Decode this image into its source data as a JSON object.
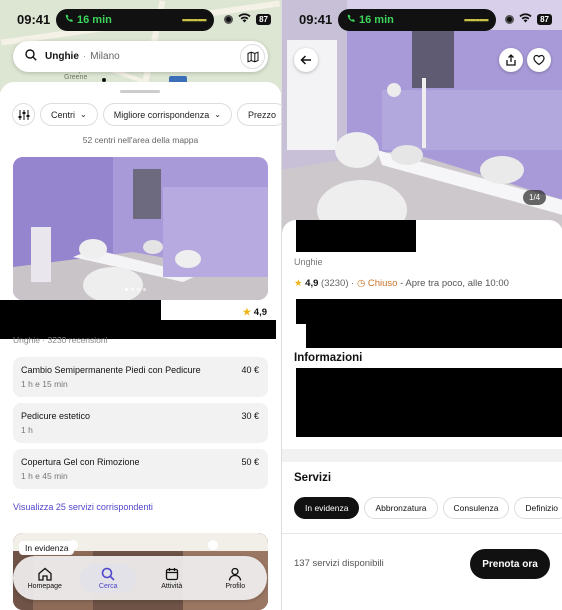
{
  "status": {
    "time": "09:41",
    "call": "16 min",
    "battery": "87"
  },
  "left": {
    "map": {
      "place_label_1": "Comprehen",
      "place_label_2": "Greene",
      "pin_label": "5"
    },
    "search": {
      "query": "Unghie",
      "separator": "·",
      "city": "Milano"
    },
    "filters": [
      "Centri",
      "Migliore corrispondenza",
      "Prezzo"
    ],
    "results_count": "52 centri nell'area della mappa",
    "listing": {
      "rating": "4,9",
      "category": "Unghie · 3230 recensioni",
      "services": [
        {
          "name": "Cambio Semipermanente Piedi con Pedicure",
          "duration": "1 h e 15 min",
          "price": "40 €"
        },
        {
          "name": "Pedicure estetico",
          "duration": "1 h",
          "price": "30 €"
        },
        {
          "name": "Copertura Gel con Rimozione",
          "duration": "1 h e 45 min",
          "price": "50 €"
        }
      ],
      "more_link": "Visualizza 25 servizi corrispondenti"
    },
    "next_badge": "In evidenza",
    "tabs": [
      {
        "label": "Homepage",
        "icon": "home-icon"
      },
      {
        "label": "Cerca",
        "icon": "search-icon"
      },
      {
        "label": "Attività",
        "icon": "calendar-icon"
      },
      {
        "label": "Profilo",
        "icon": "person-icon"
      }
    ]
  },
  "right": {
    "photo_counter": "1/4",
    "category": "Unghie",
    "rating": "4,9",
    "review_count": "(3230)",
    "dot": "·",
    "status_closed": "Chiuso",
    "status_next": "- Apre tra poco, alle 10:00",
    "info_heading": "Informazioni",
    "services_heading": "Servizi",
    "service_chips": [
      "In evidenza",
      "Abbronzatura",
      "Consulenza",
      "Definizio"
    ],
    "available": "137 servizi disponibili",
    "book_label": "Prenota ora"
  },
  "colors": {
    "accent": "#5046c9",
    "star": "#f1b418",
    "closed": "#c8742a",
    "salon_wall": "#a89ad8"
  }
}
